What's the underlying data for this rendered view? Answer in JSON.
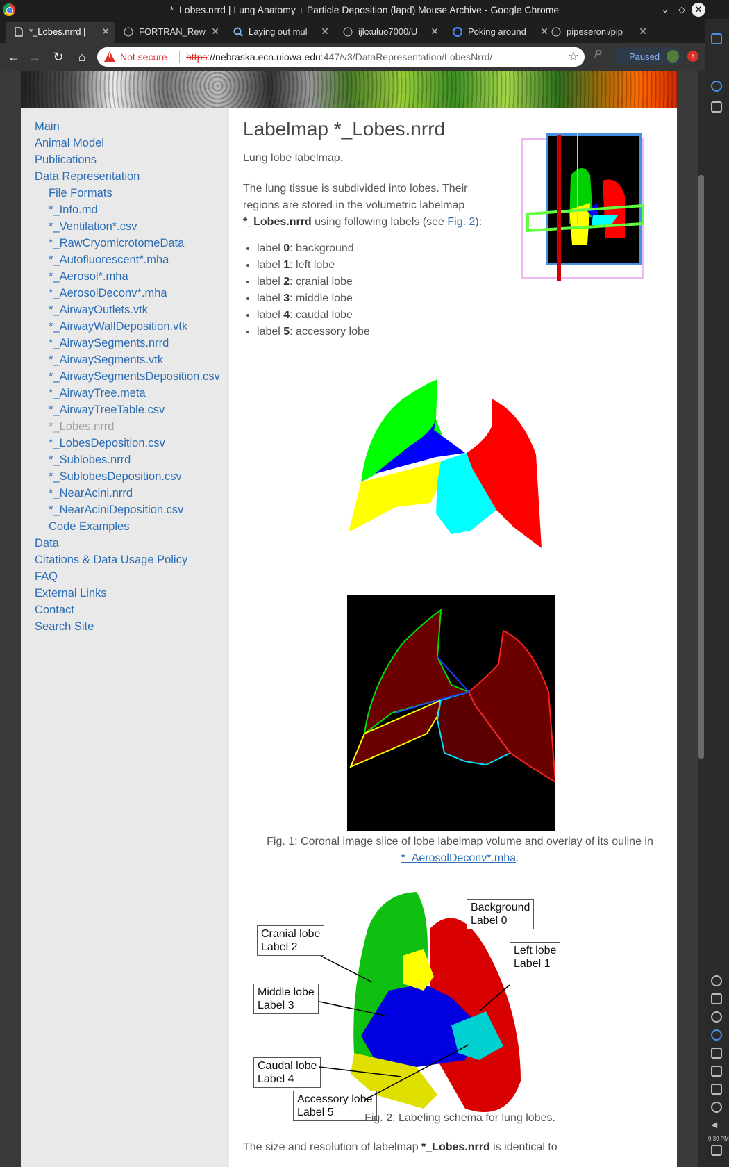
{
  "window": {
    "title": "*_Lobes.nrrd | Lung Anatomy + Particle Deposition (lapd) Mouse Archive - Google Chrome"
  },
  "tabs": [
    {
      "label": "*_Lobes.nrrd |",
      "icon": "page-icon"
    },
    {
      "label": "FORTRAN_Rew",
      "icon": "github-icon"
    },
    {
      "label": "Laying out mul",
      "icon": "search-icon"
    },
    {
      "label": "ijkxuluo7000/U",
      "icon": "github-icon"
    },
    {
      "label": "Poking around",
      "icon": "google-icon"
    },
    {
      "label": "pipeseroni/pip",
      "icon": "github-icon"
    }
  ],
  "toolbar": {
    "security": "Not secure",
    "url_scheme": "https",
    "url_host": "://nebraska.ecn.uiowa.edu",
    "url_path": ":447/v3/DataRepresentation/LobesNrrd/",
    "profile_status": "Paused"
  },
  "sidebar": {
    "items": [
      {
        "label": "Main",
        "level": 0
      },
      {
        "label": "Animal Model",
        "level": 0
      },
      {
        "label": "Publications",
        "level": 0
      },
      {
        "label": "Data Representation",
        "level": 0
      },
      {
        "label": "File Formats",
        "level": 1
      },
      {
        "label": "*_Info.md",
        "level": 1
      },
      {
        "label": "*_Ventilation*.csv",
        "level": 1
      },
      {
        "label": "*_RawCryomicrotomeData",
        "level": 1
      },
      {
        "label": "*_Autofluorescent*.mha",
        "level": 1
      },
      {
        "label": "*_Aerosol*.mha",
        "level": 1
      },
      {
        "label": "*_AerosolDeconv*.mha",
        "level": 1
      },
      {
        "label": "*_AirwayOutlets.vtk",
        "level": 1
      },
      {
        "label": "*_AirwayWallDeposition.vtk",
        "level": 1
      },
      {
        "label": "*_AirwaySegments.nrrd",
        "level": 1
      },
      {
        "label": "*_AirwaySegments.vtk",
        "level": 1
      },
      {
        "label": "*_AirwaySegmentsDeposition.csv",
        "level": 1
      },
      {
        "label": "*_AirwayTree.meta",
        "level": 1
      },
      {
        "label": "*_AirwayTreeTable.csv",
        "level": 1
      },
      {
        "label": "*_Lobes.nrrd",
        "level": 1,
        "current": true
      },
      {
        "label": "*_LobesDeposition.csv",
        "level": 1
      },
      {
        "label": "*_Sublobes.nrrd",
        "level": 1
      },
      {
        "label": "*_SublobesDeposition.csv",
        "level": 1
      },
      {
        "label": "*_NearAcini.nrrd",
        "level": 1
      },
      {
        "label": "*_NearAciniDeposition.csv",
        "level": 1
      },
      {
        "label": "Code Examples",
        "level": 1
      },
      {
        "label": "Data",
        "level": 0
      },
      {
        "label": "Citations & Data Usage Policy",
        "level": 0
      },
      {
        "label": "FAQ",
        "level": 0
      },
      {
        "label": "External Links",
        "level": 0
      },
      {
        "label": "Contact",
        "level": 0
      },
      {
        "label": "Search Site",
        "level": 0
      }
    ]
  },
  "main": {
    "title": "Labelmap *_Lobes.nrrd",
    "intro": "Lung lobe labelmap.",
    "para_line1": "The lung tissue is subdivided into lobes. Their",
    "para_line2": "regions are stored in the volumetric labelmap",
    "para_bold": "*_Lobes.nrrd",
    "para_rest": " using following labels (see ",
    "para_link": "Fig. 2",
    "para_end": "):",
    "labels": [
      {
        "prefix": "label ",
        "num": "0",
        "name": ": background"
      },
      {
        "prefix": "label ",
        "num": "1",
        "name": ": left lobe"
      },
      {
        "prefix": "label ",
        "num": "2",
        "name": ": cranial lobe"
      },
      {
        "prefix": "label ",
        "num": "3",
        "name": ": middle lobe"
      },
      {
        "prefix": "label ",
        "num": "4",
        "name": ": caudal lobe"
      },
      {
        "prefix": "label ",
        "num": "5",
        "name": ": accessory lobe"
      }
    ],
    "fig1_caption": "Fig. 1: Coronal image slice of lobe labelmap volume and overlay of its ouline in",
    "fig1_link": "*_AerosolDeconv*.mha",
    "fig1_end": ".",
    "fig2_callouts": {
      "cranial": [
        "Cranial lobe",
        "Label 2"
      ],
      "background": [
        "Background",
        "Label 0"
      ],
      "left": [
        "Left lobe",
        "Label 1"
      ],
      "middle": [
        "Middle lobe",
        "Label 3"
      ],
      "caudal": [
        "Caudal lobe",
        "Label 4"
      ],
      "accessory": [
        "Accessory lobe",
        "Label 5"
      ]
    },
    "fig2_caption": "Fig. 2: Labeling schema for lung lobes.",
    "trailing_bold": "*_Lobes.nrrd",
    "trailing_start": "The size and resolution of labelmap ",
    "trailing_end": " is identical to"
  },
  "colors": {
    "left_lobe": "#ff0000",
    "cranial_lobe": "#00ff00",
    "middle_lobe": "#0000ff",
    "caudal_lobe": "#ffff00",
    "accessory_lobe": "#00ffff",
    "link": "#2a6db5"
  }
}
